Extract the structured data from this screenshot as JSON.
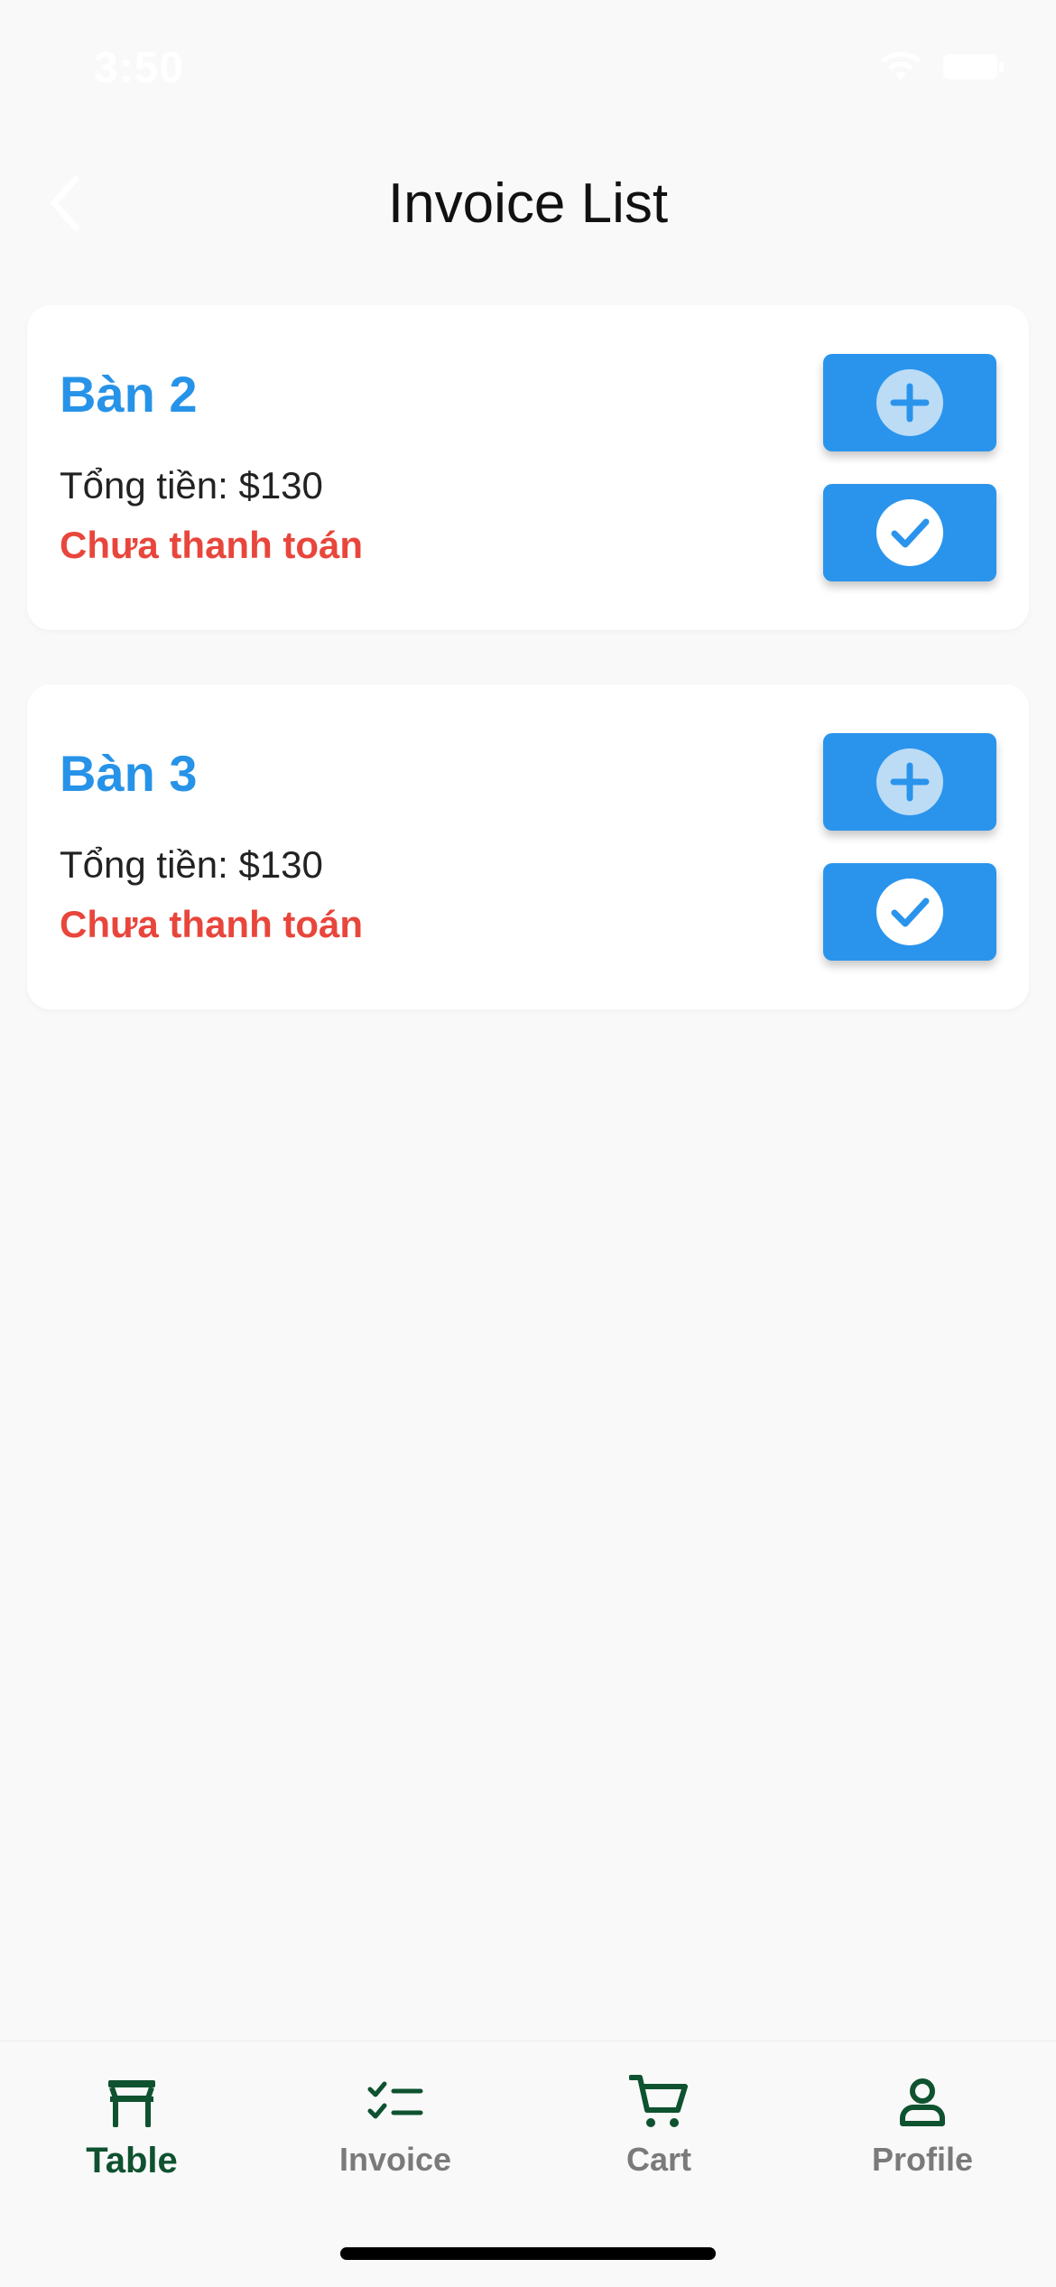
{
  "status_bar": {
    "time": "3:50",
    "wifi_icon": "wifi-icon",
    "battery_icon": "battery-icon"
  },
  "nav": {
    "title": "Invoice List",
    "back_icon": "chevron-left-icon"
  },
  "invoices": [
    {
      "table": "Bàn 2",
      "total": "Tổng tiền: $130",
      "status": "Chưa thanh toán",
      "add_icon": "plus-circle-icon",
      "pay_icon": "check-circle-icon"
    },
    {
      "table": "Bàn 3",
      "total": "Tổng tiền: $130",
      "status": "Chưa thanh toán",
      "add_icon": "plus-circle-icon",
      "pay_icon": "check-circle-icon"
    }
  ],
  "tabs": [
    {
      "label": "Table",
      "icon": "table-icon",
      "active": true
    },
    {
      "label": "Invoice",
      "icon": "checklist-icon",
      "active": false
    },
    {
      "label": "Cart",
      "icon": "cart-icon",
      "active": false
    },
    {
      "label": "Profile",
      "icon": "profile-icon",
      "active": false
    }
  ],
  "colors": {
    "accent_blue": "#2a94ec",
    "title_blue": "#2793e8",
    "unpaid_red": "#e8463c",
    "tab_active": "#0f5230",
    "tab_inactive": "#7a7a7a",
    "background": "#f9f9f9"
  }
}
